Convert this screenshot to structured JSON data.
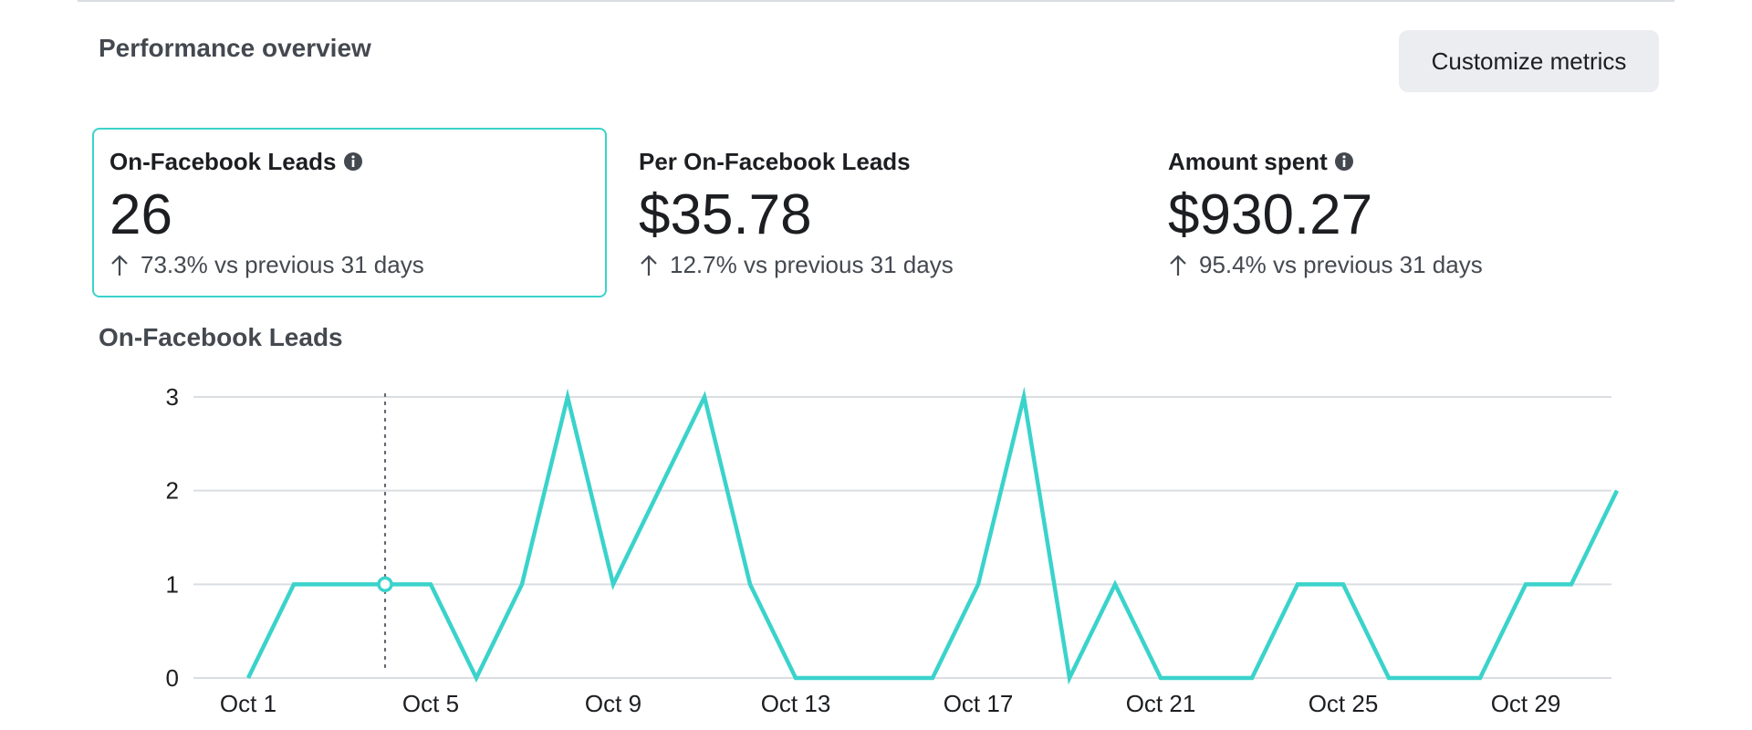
{
  "section_title": "Performance overview",
  "customize_button_label": "Customize metrics",
  "metrics": [
    {
      "label": "On-Facebook Leads",
      "has_info_icon": true,
      "value": "26",
      "change_direction": "up",
      "change_text": "73.3% vs previous 31 days",
      "selected": true
    },
    {
      "label": "Per On-Facebook Leads",
      "has_info_icon": false,
      "value": "$35.78",
      "change_direction": "up",
      "change_text": "12.7% vs previous 31 days",
      "selected": false
    },
    {
      "label": "Amount spent",
      "has_info_icon": true,
      "value": "$930.27",
      "change_direction": "up",
      "change_text": "95.4% vs previous 31 days",
      "selected": false
    }
  ],
  "chart_title": "On-Facebook Leads",
  "colors": {
    "accent": "#3ad3cb",
    "gridline": "#dadde1",
    "button_bg": "#ebedf0",
    "muted_text": "#444950"
  },
  "chart_data": {
    "type": "line",
    "title": "On-Facebook Leads",
    "xlabel": "",
    "ylabel": "",
    "x": [
      "Oct 1",
      "Oct 2",
      "Oct 3",
      "Oct 4",
      "Oct 5",
      "Oct 6",
      "Oct 7",
      "Oct 8",
      "Oct 9",
      "Oct 10",
      "Oct 11",
      "Oct 12",
      "Oct 13",
      "Oct 14",
      "Oct 15",
      "Oct 16",
      "Oct 17",
      "Oct 18",
      "Oct 19",
      "Oct 20",
      "Oct 21",
      "Oct 22",
      "Oct 23",
      "Oct 24",
      "Oct 25",
      "Oct 26",
      "Oct 27",
      "Oct 28",
      "Oct 29",
      "Oct 30",
      "Oct 31"
    ],
    "series": [
      {
        "values": [
          0,
          1,
          1,
          1,
          1,
          0,
          1,
          3,
          1,
          2,
          3,
          1,
          0,
          0,
          0,
          0,
          1,
          3,
          0,
          1,
          0,
          0,
          0,
          1,
          1,
          0,
          0,
          0,
          1,
          1,
          2
        ]
      }
    ],
    "x_tick_labels": [
      "Oct 1",
      "Oct 5",
      "Oct 9",
      "Oct 13",
      "Oct 17",
      "Oct 21",
      "Oct 25",
      "Oct 29"
    ],
    "y_tick_labels": [
      "0",
      "1",
      "2",
      "3"
    ],
    "ylim": [
      0,
      3
    ],
    "grid": true,
    "legend": "none",
    "hover_marker": {
      "x": "Oct 4",
      "y": 1
    }
  }
}
